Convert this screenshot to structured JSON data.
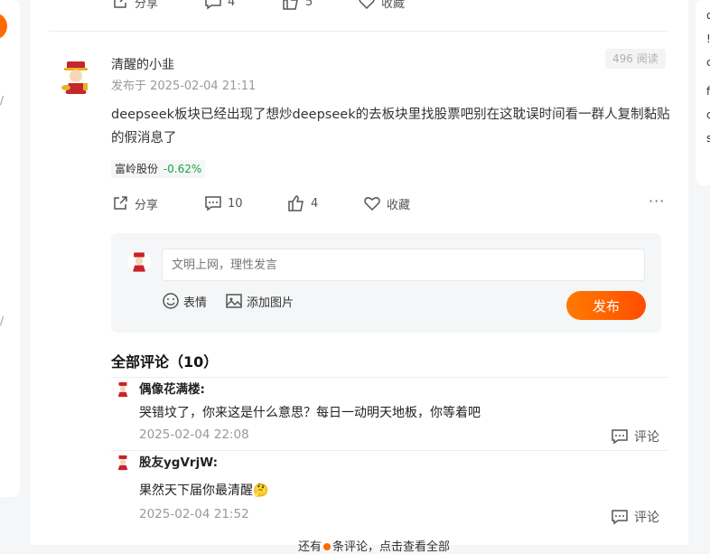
{
  "left_sidebar": {
    "marks": [
      "/",
      "/"
    ]
  },
  "right_sidebar": {
    "chars": [
      "o",
      "!",
      "c",
      "f",
      "c",
      "s"
    ]
  },
  "prev_post": {
    "share_label": "分享",
    "comment_count": "4",
    "like_count": "5",
    "fav_label": "收藏",
    "more": "···"
  },
  "post": {
    "author": "清醒的小韭",
    "time": "发布于 2025-02-04 21:11",
    "views": "496 阅读",
    "body": "deepseek板块已经出现了想炒deepseek的去板块里找股票吧别在这耽误时间看一群人复制黏贴的假消息了",
    "stock": {
      "name": "富岭股份",
      "change": "-0.62%"
    },
    "share_label": "分享",
    "comment_count": "10",
    "like_count": "4",
    "fav_label": "收藏",
    "more": "···"
  },
  "reply": {
    "placeholder": "文明上网，理性发言",
    "emoji_label": "表情",
    "image_label": "添加图片",
    "publish_label": "发布"
  },
  "comments": {
    "title": "全部评论（10）",
    "reply_label": "评论",
    "items": [
      {
        "name": "偶像花满楼:",
        "text": "哭错坟了，你来这是什么意思？每日一动明天地板，你等着吧",
        "time": "2025-02-04 22:08"
      },
      {
        "name": "股友ygVrjW:",
        "text": "果然天下届你最清醒",
        "emoji": "🤔",
        "time": "2025-02-04 21:52"
      }
    ],
    "see_all_prefix": "还有",
    "see_all_suffix": "条评论，点击查看全部"
  },
  "colors": {
    "accent": "#ff6a00",
    "stock_down": "#1aa34a"
  }
}
